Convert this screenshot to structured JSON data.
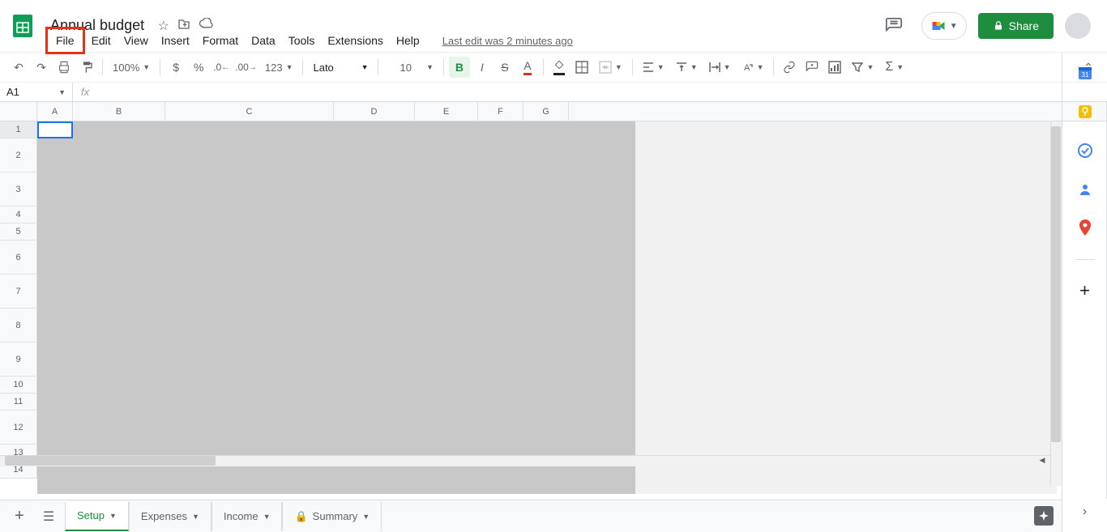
{
  "doc": {
    "title": "Annual budget",
    "last_edit": "Last edit was 2 minutes ago"
  },
  "menus": [
    "File",
    "Edit",
    "View",
    "Insert",
    "Format",
    "Data",
    "Tools",
    "Extensions",
    "Help"
  ],
  "highlighted_menu": "File",
  "share_label": "Share",
  "toolbar": {
    "zoom": "100%",
    "num_format": "123",
    "font": "Lato",
    "font_size": "10"
  },
  "formula_bar": {
    "cell_ref": "A1",
    "fx": "fx",
    "value": ""
  },
  "columns": [
    "A",
    "B",
    "C",
    "D",
    "E",
    "F",
    "G"
  ],
  "rows": [
    {
      "n": "1",
      "tall": false
    },
    {
      "n": "2",
      "tall": true
    },
    {
      "n": "3",
      "tall": true
    },
    {
      "n": "4",
      "tall": false
    },
    {
      "n": "5",
      "tall": false
    },
    {
      "n": "6",
      "tall": true
    },
    {
      "n": "7",
      "tall": true
    },
    {
      "n": "8",
      "tall": true
    },
    {
      "n": "9",
      "tall": true
    },
    {
      "n": "10",
      "tall": false
    },
    {
      "n": "11",
      "tall": false
    },
    {
      "n": "12",
      "tall": true
    },
    {
      "n": "13",
      "tall": false
    },
    {
      "n": "14",
      "tall": false
    }
  ],
  "sheet_tabs": [
    {
      "name": "Setup",
      "locked": false,
      "active": true
    },
    {
      "name": "Expenses",
      "locked": false,
      "active": false
    },
    {
      "name": "Income",
      "locked": false,
      "active": false
    },
    {
      "name": "Summary",
      "locked": true,
      "active": false
    }
  ],
  "side_apps": [
    "calendar",
    "keep",
    "tasks",
    "contacts",
    "maps"
  ]
}
